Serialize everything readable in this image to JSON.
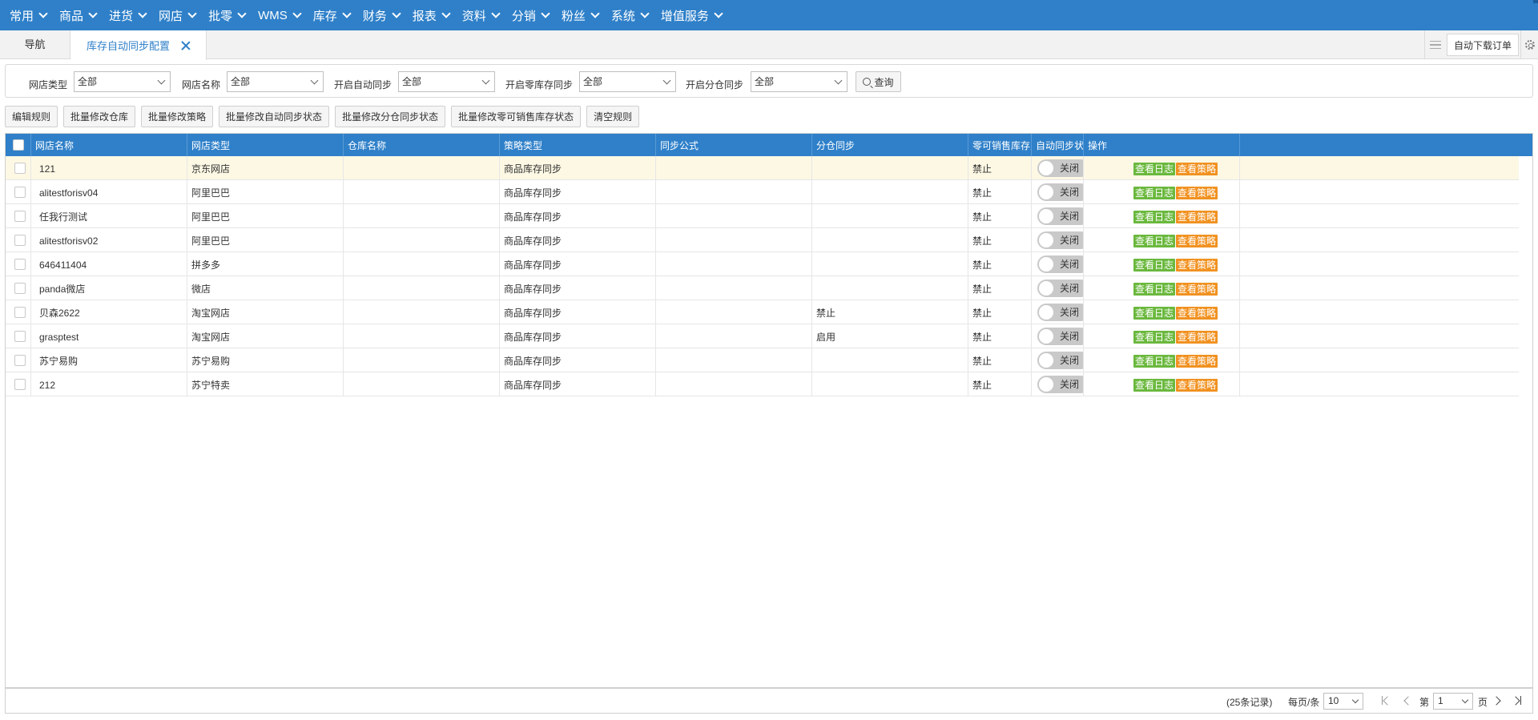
{
  "topnav": {
    "items": [
      "常用",
      "商品",
      "进货",
      "网店",
      "批零",
      "WMS",
      "库存",
      "财务",
      "报表",
      "资料",
      "分销",
      "粉丝",
      "系统",
      "增值服务"
    ]
  },
  "tabs": {
    "nav_label": "导航",
    "active_label": "库存自动同步配置",
    "auto_order_label": "自动下载订单"
  },
  "filters": {
    "shop_type_label": "网店类型",
    "shop_type_value": "全部",
    "shop_name_label": "网店名称",
    "shop_name_value": "全部",
    "auto_sync_label": "开启自动同步",
    "auto_sync_value": "全部",
    "zero_stock_label": "开启零库存同步",
    "zero_stock_value": "全部",
    "split_sync_label": "开启分仓同步",
    "split_sync_value": "全部",
    "query_label": "查询"
  },
  "actions": {
    "edit_rule": "编辑规则",
    "batch_warehouse": "批量修改仓库",
    "batch_strategy": "批量修改策略",
    "batch_auto_sync": "批量修改自动同步状态",
    "batch_split_sync": "批量修改分仓同步状态",
    "batch_zero_stock": "批量修改零可销售库存状态",
    "clear_rule": "清空规则"
  },
  "table": {
    "columns": [
      "网店名称",
      "网店类型",
      "仓库名称",
      "策略类型",
      "同步公式",
      "分仓同步",
      "零可销售库存则",
      "自动同步状态",
      "操作"
    ],
    "toggle_label": "关闭",
    "log_button": "查看日志",
    "strategy_button": "查看策略",
    "rows": [
      {
        "shop": "121",
        "type": "京东网店",
        "warehouse": "",
        "strategy": "商品库存同步",
        "formula": "",
        "split": "",
        "zero": "禁止"
      },
      {
        "shop": "alitestforisv04",
        "type": "阿里巴巴",
        "warehouse": "",
        "strategy": "商品库存同步",
        "formula": "",
        "split": "",
        "zero": "禁止"
      },
      {
        "shop": "任我行测试",
        "type": "阿里巴巴",
        "warehouse": "",
        "strategy": "商品库存同步",
        "formula": "",
        "split": "",
        "zero": "禁止"
      },
      {
        "shop": "alitestforisv02",
        "type": "阿里巴巴",
        "warehouse": "",
        "strategy": "商品库存同步",
        "formula": "",
        "split": "",
        "zero": "禁止"
      },
      {
        "shop": "646411404",
        "type": "拼多多",
        "warehouse": "",
        "strategy": "商品库存同步",
        "formula": "",
        "split": "",
        "zero": "禁止"
      },
      {
        "shop": "panda微店",
        "type": "微店",
        "warehouse": "",
        "strategy": "商品库存同步",
        "formula": "",
        "split": "",
        "zero": "禁止"
      },
      {
        "shop": "贝森2622",
        "type": "淘宝网店",
        "warehouse": "",
        "strategy": "商品库存同步",
        "formula": "",
        "split": "禁止",
        "zero": "禁止"
      },
      {
        "shop": "grasptest",
        "type": "淘宝网店",
        "warehouse": "",
        "strategy": "商品库存同步",
        "formula": "",
        "split": "启用",
        "zero": "禁止"
      },
      {
        "shop": "苏宁易购",
        "type": "苏宁易购",
        "warehouse": "",
        "strategy": "商品库存同步",
        "formula": "",
        "split": "",
        "zero": "禁止"
      },
      {
        "shop": "212",
        "type": "苏宁特卖",
        "warehouse": "",
        "strategy": "商品库存同步",
        "formula": "",
        "split": "",
        "zero": "禁止"
      }
    ]
  },
  "pager": {
    "total_text": "(25条记录)",
    "per_page_label": "每页/条",
    "per_page_value": "10",
    "page_prefix": "第",
    "page_value": "1",
    "page_suffix": "页"
  },
  "colors": {
    "primary": "#2f80c9",
    "log_button": "#6ab83d",
    "strategy_button": "#f19120",
    "selected_row": "#fdf8e4"
  }
}
